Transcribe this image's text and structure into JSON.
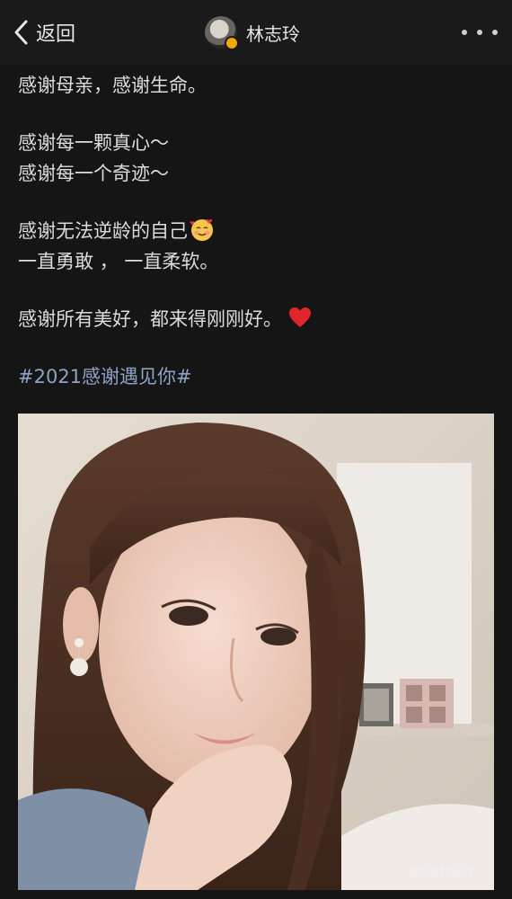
{
  "header": {
    "back_label": "返回",
    "user_name": "林志玲"
  },
  "post": {
    "lines": [
      "感谢母亲，感谢生命。",
      "感谢每一颗真心～",
      "感谢每一个奇迹～",
      "感谢无法逆龄的自己",
      "一直勇敢 ， 一直柔软。",
      "感谢所有美好，都来得刚刚好。"
    ],
    "hashtag": "#2021感谢遇见你#"
  },
  "photo": {
    "watermark": "@林志玲"
  },
  "colors": {
    "background": "#151515",
    "text": "#dcdcdc",
    "hashtag": "#8da3c6"
  }
}
